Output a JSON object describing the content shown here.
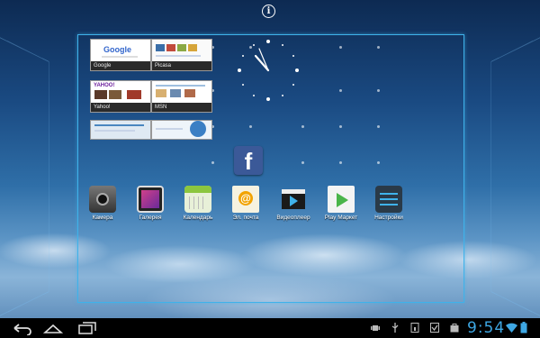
{
  "thumbnails": [
    {
      "label": "Google"
    },
    {
      "label": "Picasa"
    },
    {
      "label": "Yahoo!"
    },
    {
      "label": "MSN"
    }
  ],
  "google_logo": "Google",
  "yahoo_logo": "YAHOO!",
  "facebook_glyph": "f",
  "apps": [
    {
      "label": "Камера"
    },
    {
      "label": "Галерея"
    },
    {
      "label": "Календарь"
    },
    {
      "label": "Эл. почта"
    },
    {
      "label": "Видеоплеер"
    },
    {
      "label": "Play Маркет"
    },
    {
      "label": "Настройки"
    }
  ],
  "info_glyph": "i",
  "status": {
    "time": "9:54"
  },
  "colors": {
    "accent": "#3fb2ea",
    "clock_text": "#3ea7e3",
    "facebook": "#3b5998"
  }
}
